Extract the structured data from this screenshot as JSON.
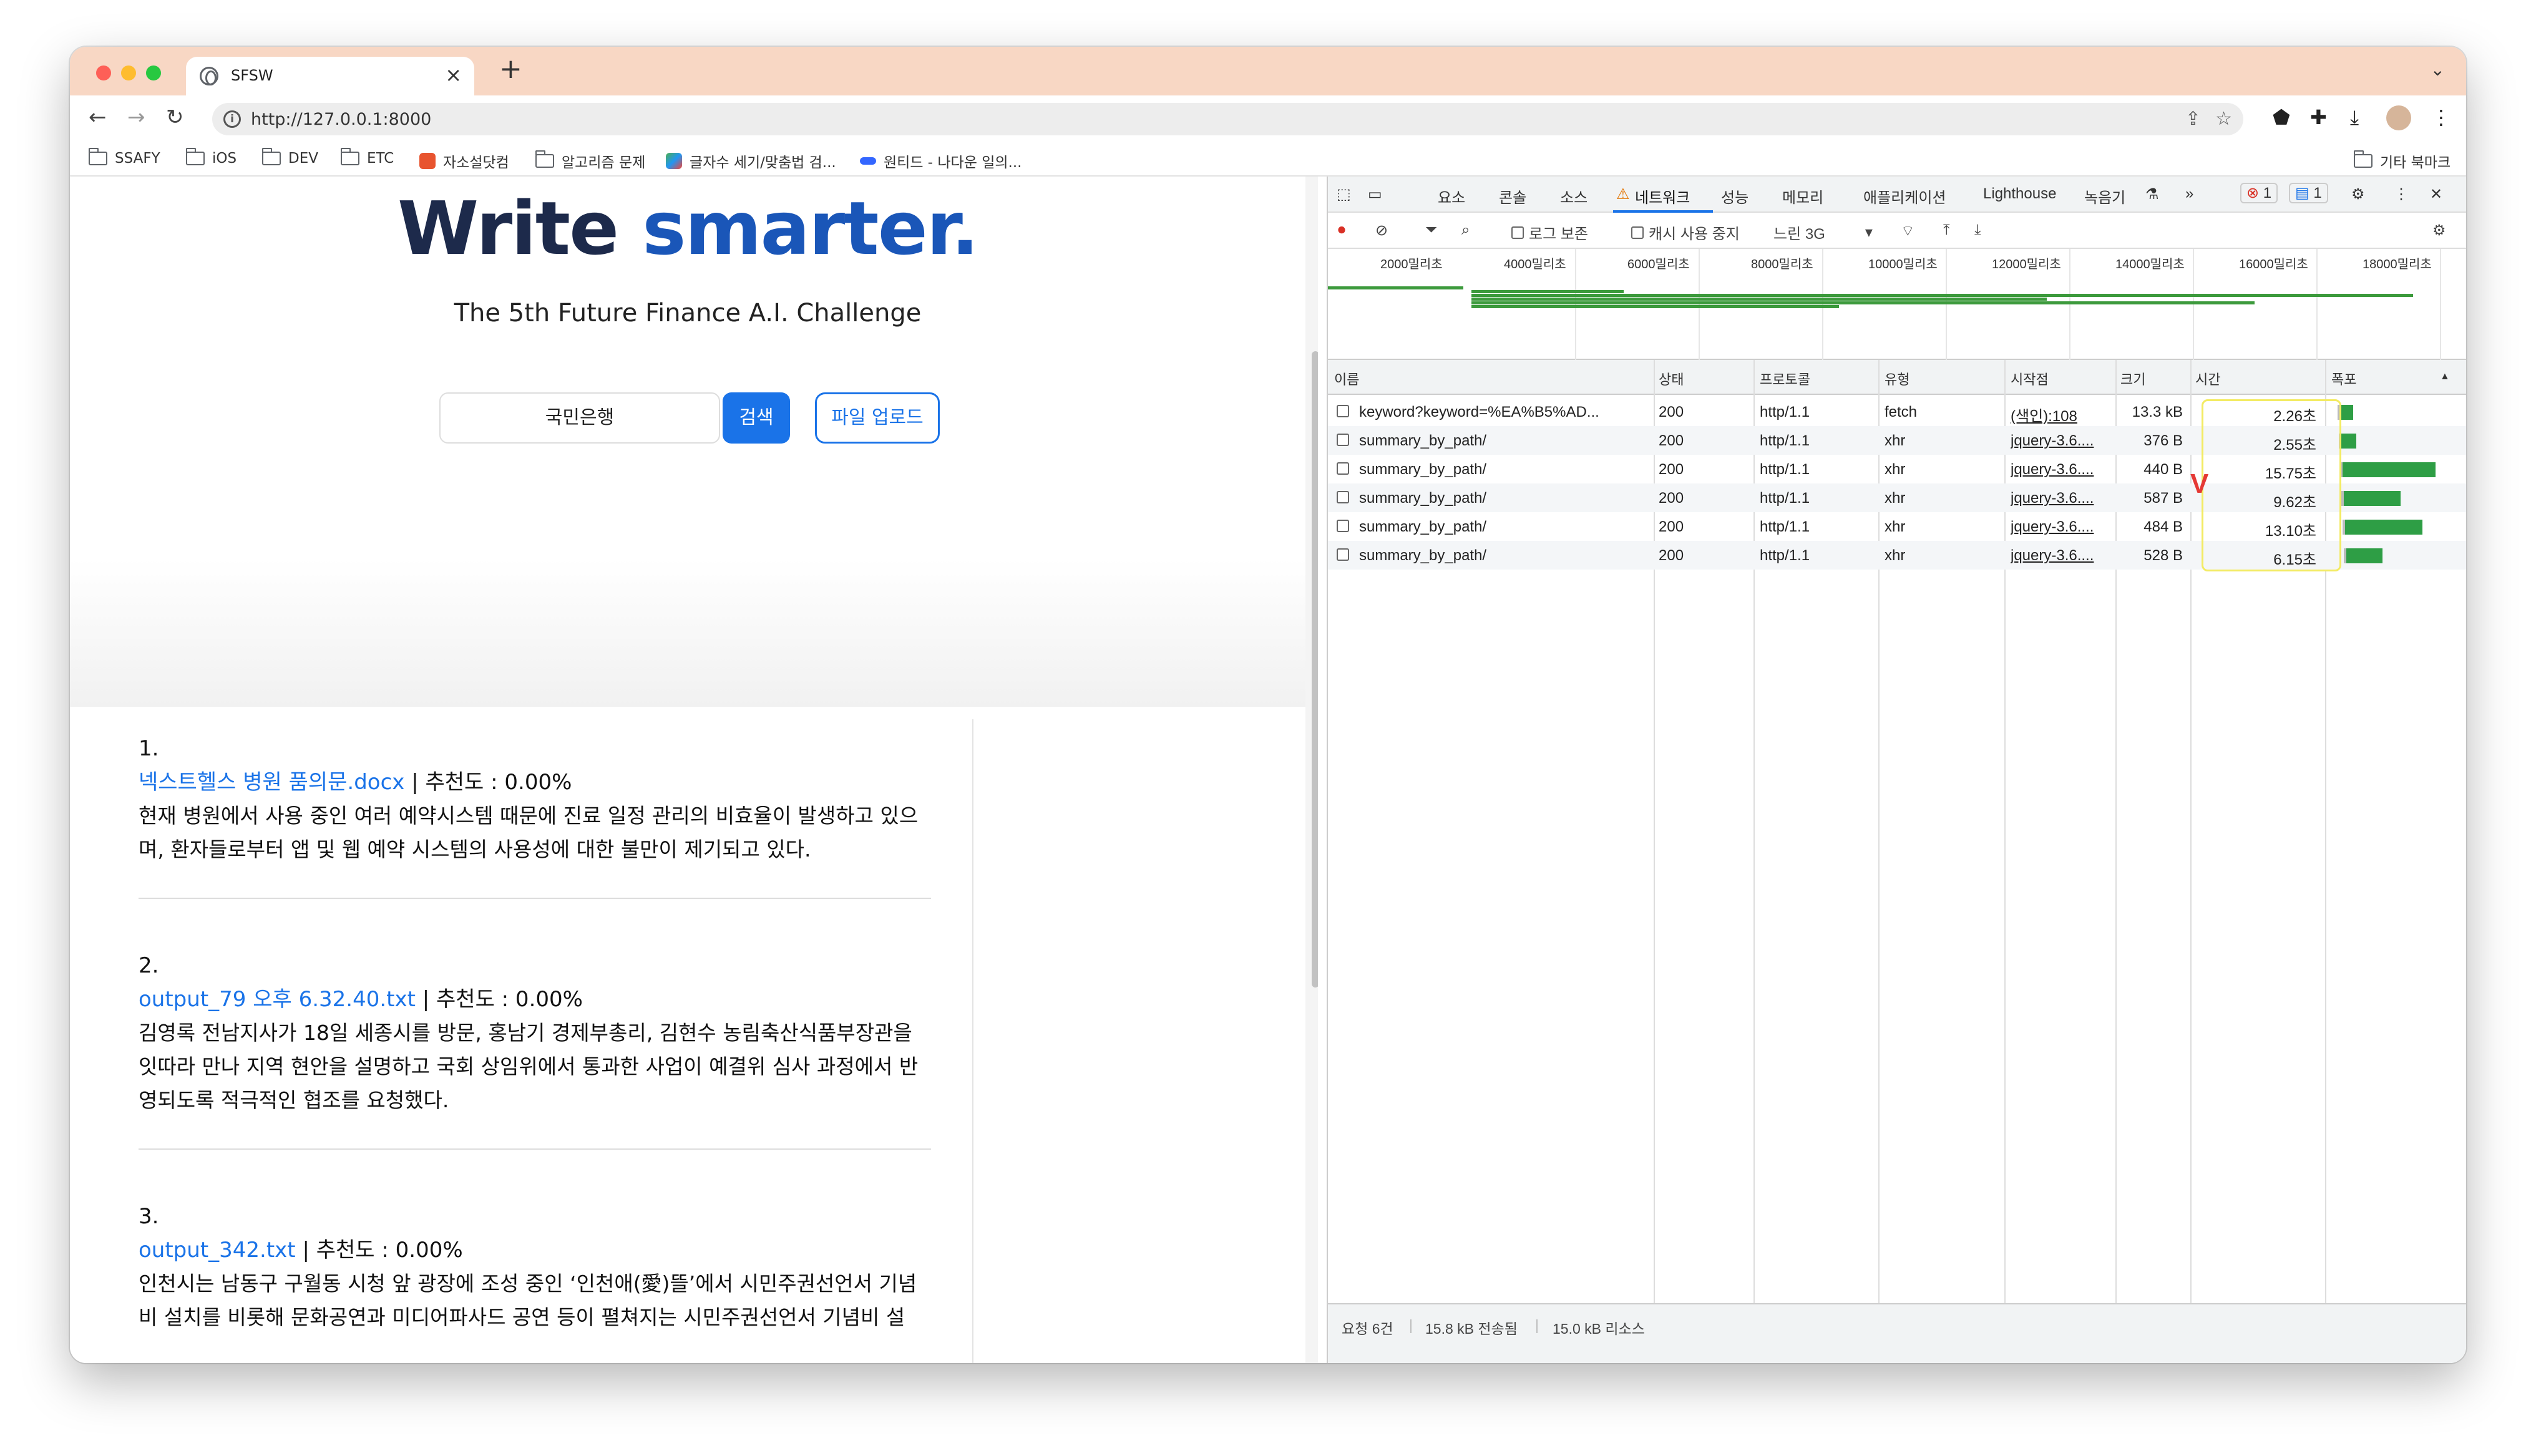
{
  "browser": {
    "tab_title": "SFSW",
    "url": "http://127.0.0.1:8000",
    "bookmarks": [
      {
        "label": "SSAFY"
      },
      {
        "label": "iOS"
      },
      {
        "label": "DEV"
      },
      {
        "label": "ETC"
      },
      {
        "label": "자소설닷컴"
      },
      {
        "label": "알고리즘 문제"
      },
      {
        "label": "글자수 세기/맞춤법 검..."
      },
      {
        "label": "원티드 - 나다운 일의..."
      }
    ],
    "other_bookmarks": "기타 북마크"
  },
  "page": {
    "headline_a": "Write",
    "headline_b": "smarter.",
    "subtitle": "The 5th Future Finance A.I. Challenge",
    "search_value": "국민은행",
    "search_button": "검색",
    "upload_button": "파일 업로드",
    "results": [
      {
        "num": "1.",
        "link": "넥스트헬스 병원 품의문.docx",
        "meta": " | 추천도 : 0.00%",
        "body": [
          "현재 병원에서 사용 중인 여러 예약시스템 때문에 진료 일정 관리의 비효율이 발생하고 있으",
          "며, 환자들로부터 앱 및 웹 예약 시스템의 사용성에 대한 불만이 제기되고 있다."
        ]
      },
      {
        "num": "2.",
        "link": "output_79 오후 6.32.40.txt",
        "meta": " | 추천도 : 0.00%",
        "body": [
          "김영록 전남지사가 18일 세종시를 방문, 홍남기 경제부총리, 김현수 농림축산식품부장관을",
          "잇따라 만나 지역 현안을 설명하고 국회 상임위에서 통과한 사업이 예결위 심사 과정에서 반",
          "영되도록 적극적인 협조를 요청했다."
        ]
      },
      {
        "num": "3.",
        "link": "output_342.txt",
        "meta": " | 추천도 : 0.00%",
        "body": [
          "인천시는 남동구 구월동 시청 앞 광장에 조성 중인 ‘인천애(愛)뜰’에서 시민주권선언서 기념",
          "비 설치를 비롯해 문화공연과 미디어파사드 공연 등이 펼쳐지는 시민주권선언서 기념비 설"
        ]
      }
    ]
  },
  "devtools": {
    "tabs": [
      "요소",
      "콘솔",
      "소스",
      "네트워크",
      "성능",
      "메모리",
      "애플리케이션",
      "Lighthouse",
      "녹음기"
    ],
    "error_count": "1",
    "message_count": "1",
    "preserve_log": "로그 보존",
    "disable_cache": "캐시 사용 중지",
    "throttle": "느린 3G",
    "timeline_labels": [
      "2000밀리초",
      "4000밀리초",
      "6000밀리초",
      "8000밀리초",
      "10000밀리초",
      "12000밀리초",
      "14000밀리초",
      "16000밀리초",
      "18000밀리초"
    ],
    "columns": {
      "name": "이름",
      "status": "상태",
      "protocol": "프로토콜",
      "type": "유형",
      "initiator": "시작점",
      "size": "크기",
      "time": "시간",
      "waterfall": "폭포"
    },
    "requests": [
      {
        "name": "keyword?keyword=%EA%B5%AD...",
        "status": "200",
        "protocol": "http/1.1",
        "type": "fetch",
        "initiator": "(색인):108",
        "size": "13.3 kB",
        "time": "2.26초",
        "seconds": 2.26
      },
      {
        "name": "summary_by_path/",
        "status": "200",
        "protocol": "http/1.1",
        "type": "xhr",
        "initiator": "jquery-3.6....",
        "size": "376 B",
        "time": "2.55초",
        "seconds": 2.55
      },
      {
        "name": "summary_by_path/",
        "status": "200",
        "protocol": "http/1.1",
        "type": "xhr",
        "initiator": "jquery-3.6....",
        "size": "440 B",
        "time": "15.75초",
        "seconds": 15.75
      },
      {
        "name": "summary_by_path/",
        "status": "200",
        "protocol": "http/1.1",
        "type": "xhr",
        "initiator": "jquery-3.6....",
        "size": "587 B",
        "time": "9.62초",
        "seconds": 9.62
      },
      {
        "name": "summary_by_path/",
        "status": "200",
        "protocol": "http/1.1",
        "type": "xhr",
        "initiator": "jquery-3.6....",
        "size": "484 B",
        "time": "13.10초",
        "seconds": 13.1
      },
      {
        "name": "summary_by_path/",
        "status": "200",
        "protocol": "http/1.1",
        "type": "xhr",
        "initiator": "jquery-3.6....",
        "size": "528 B",
        "time": "6.15초",
        "seconds": 6.15
      }
    ],
    "status_bar": {
      "requests": "요청 6건",
      "transferred": "15.8 kB 전송됨",
      "resources": "15.0 kB 리소스"
    },
    "colors": {
      "accent": "#1a73e8",
      "waterfall": "#2e9e45",
      "highlight": "#f3eb63"
    }
  }
}
